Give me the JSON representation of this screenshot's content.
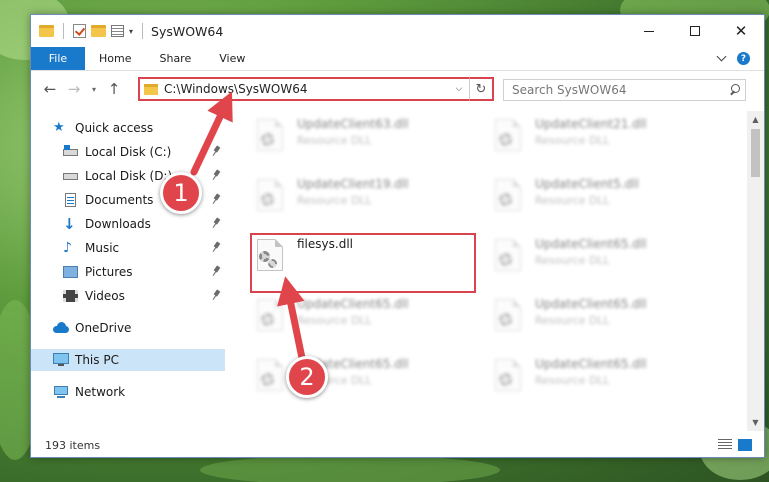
{
  "window": {
    "title": "SysWOW64",
    "minimize_glyph": "—",
    "close_glyph": "✕"
  },
  "ribbon": {
    "tabs": [
      "File",
      "Home",
      "Share",
      "View"
    ]
  },
  "navigation": {
    "back_glyph": "←",
    "forward_glyph": "→",
    "recent_glyph": "▾",
    "up_glyph": "↑",
    "address": "C:\\Windows\\SysWOW64",
    "dropdown_glyph": "⌵",
    "refresh_glyph": "↻",
    "search_placeholder": "Search SysWOW64"
  },
  "sidebar": {
    "items": [
      {
        "label": "Quick access",
        "icon": "star-icon",
        "pinned": false
      },
      {
        "label": "Local Disk (C:)",
        "icon": "drive-icon",
        "pinned": true
      },
      {
        "label": "Local Disk (D:)",
        "icon": "drive-icon",
        "pinned": true
      },
      {
        "label": "Documents",
        "icon": "documents-icon",
        "pinned": true
      },
      {
        "label": "Downloads",
        "icon": "download-icon",
        "pinned": true
      },
      {
        "label": "Music",
        "icon": "music-icon",
        "pinned": true
      },
      {
        "label": "Pictures",
        "icon": "pictures-icon",
        "pinned": true
      },
      {
        "label": "Videos",
        "icon": "videos-icon",
        "pinned": true
      },
      {
        "label": "OneDrive",
        "icon": "cloud-icon",
        "pinned": false
      },
      {
        "label": "This PC",
        "icon": "computer-icon",
        "pinned": false,
        "selected": true
      },
      {
        "label": "Network",
        "icon": "network-icon",
        "pinned": false
      }
    ]
  },
  "files": [
    {
      "name": "UpdateClient63.dll",
      "type": "Resource DLL",
      "blurred": true
    },
    {
      "name": "UpdateClient21.dll",
      "type": "Resource DLL",
      "blurred": true
    },
    {
      "name": "UpdateClient19.dll",
      "type": "Resource DLL",
      "blurred": true
    },
    {
      "name": "UpdateClient5.dll",
      "type": "Resource DLL",
      "blurred": true
    },
    {
      "name": "filesys.dll",
      "type": "",
      "blurred": false
    },
    {
      "name": "UpdateClient65.dll",
      "type": "Resource DLL",
      "blurred": true
    },
    {
      "name": "UpdateClient65.dll",
      "type": "Resource DLL",
      "blurred": true
    },
    {
      "name": "UpdateClient65.dll",
      "type": "Resource DLL",
      "blurred": true
    },
    {
      "name": "UpdateClient65.dll",
      "type": "Resource DLL",
      "blurred": true
    },
    {
      "name": "UpdateClient65.dll",
      "type": "Resource DLL",
      "blurred": true
    }
  ],
  "status": {
    "item_count": "193 items"
  },
  "annotations": {
    "step1": "1",
    "step2": "2"
  },
  "colors": {
    "accent": "#1979ca",
    "highlight": "#d9434d",
    "badge": "#e0454b",
    "selected": "#cce4f7"
  }
}
